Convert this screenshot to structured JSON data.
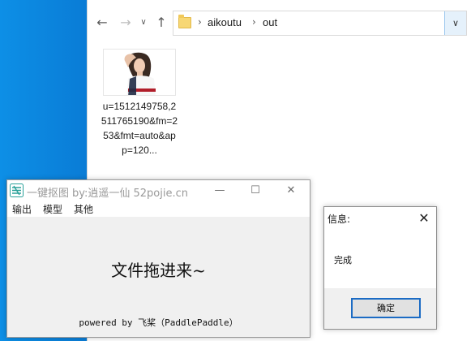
{
  "explorer": {
    "breadcrumbs": [
      "aikoutu",
      "out"
    ],
    "file": {
      "name": "u=1512149758,2511765190&fm=253&fmt=auto&app=120...",
      "icon": "image-thumbnail"
    }
  },
  "app": {
    "title": "一键抠图",
    "subtitle": "by:逍遥一仙 52pojie.cn",
    "menu": [
      "输出",
      "模型",
      "其他"
    ],
    "drop_hint": "文件拖进来~",
    "powered_by": "powered by 飞桨（PaddlePaddle）"
  },
  "dialog": {
    "title": "信息:",
    "message": "完成",
    "ok_label": "确定"
  },
  "colors": {
    "desktop": "#0a78d2",
    "dialog_button_border": "#1b6bc4",
    "folder": "#f7d774"
  }
}
